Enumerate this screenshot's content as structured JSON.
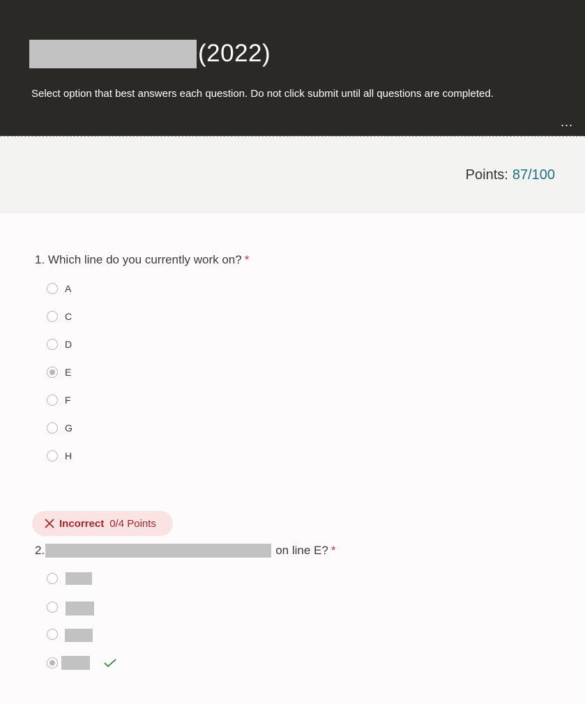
{
  "header": {
    "title_suffix": "(2022)",
    "description": "Select option that best answers each question. Do not click submit until all questions are completed.",
    "more_label": "..."
  },
  "points": {
    "label": "Points:",
    "value": "87/100"
  },
  "questions": [
    {
      "number": "1.",
      "text": "Which line do you currently work on?",
      "required_mark": "*",
      "options": [
        "A",
        "C",
        "D",
        "E",
        "F",
        "G",
        "H"
      ],
      "selected": "E"
    },
    {
      "number": "2.",
      "text_suffix": "on line E?",
      "required_mark": "*",
      "result": {
        "status": "Incorrect",
        "points": "0/4 Points"
      },
      "selected_option_index": 3,
      "correct_option_index": 3
    }
  ],
  "colors": {
    "header_bg": "#2b2926",
    "points_value": "#1e6f7d",
    "incorrect": "#a4262c",
    "correct_check": "#2e7d32"
  }
}
